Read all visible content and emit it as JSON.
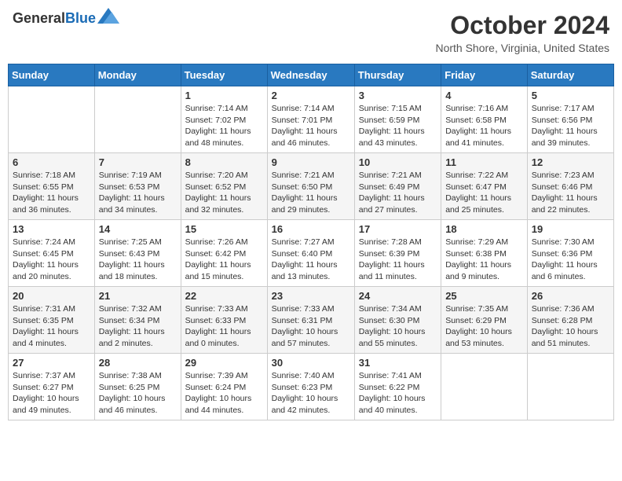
{
  "header": {
    "logo_line1": "General",
    "logo_line2": "Blue",
    "month_title": "October 2024",
    "location": "North Shore, Virginia, United States"
  },
  "days_of_week": [
    "Sunday",
    "Monday",
    "Tuesday",
    "Wednesday",
    "Thursday",
    "Friday",
    "Saturday"
  ],
  "weeks": [
    [
      {
        "day": "",
        "info": ""
      },
      {
        "day": "",
        "info": ""
      },
      {
        "day": "1",
        "info": "Sunrise: 7:14 AM\nSunset: 7:02 PM\nDaylight: 11 hours and 48 minutes."
      },
      {
        "day": "2",
        "info": "Sunrise: 7:14 AM\nSunset: 7:01 PM\nDaylight: 11 hours and 46 minutes."
      },
      {
        "day": "3",
        "info": "Sunrise: 7:15 AM\nSunset: 6:59 PM\nDaylight: 11 hours and 43 minutes."
      },
      {
        "day": "4",
        "info": "Sunrise: 7:16 AM\nSunset: 6:58 PM\nDaylight: 11 hours and 41 minutes."
      },
      {
        "day": "5",
        "info": "Sunrise: 7:17 AM\nSunset: 6:56 PM\nDaylight: 11 hours and 39 minutes."
      }
    ],
    [
      {
        "day": "6",
        "info": "Sunrise: 7:18 AM\nSunset: 6:55 PM\nDaylight: 11 hours and 36 minutes."
      },
      {
        "day": "7",
        "info": "Sunrise: 7:19 AM\nSunset: 6:53 PM\nDaylight: 11 hours and 34 minutes."
      },
      {
        "day": "8",
        "info": "Sunrise: 7:20 AM\nSunset: 6:52 PM\nDaylight: 11 hours and 32 minutes."
      },
      {
        "day": "9",
        "info": "Sunrise: 7:21 AM\nSunset: 6:50 PM\nDaylight: 11 hours and 29 minutes."
      },
      {
        "day": "10",
        "info": "Sunrise: 7:21 AM\nSunset: 6:49 PM\nDaylight: 11 hours and 27 minutes."
      },
      {
        "day": "11",
        "info": "Sunrise: 7:22 AM\nSunset: 6:47 PM\nDaylight: 11 hours and 25 minutes."
      },
      {
        "day": "12",
        "info": "Sunrise: 7:23 AM\nSunset: 6:46 PM\nDaylight: 11 hours and 22 minutes."
      }
    ],
    [
      {
        "day": "13",
        "info": "Sunrise: 7:24 AM\nSunset: 6:45 PM\nDaylight: 11 hours and 20 minutes."
      },
      {
        "day": "14",
        "info": "Sunrise: 7:25 AM\nSunset: 6:43 PM\nDaylight: 11 hours and 18 minutes."
      },
      {
        "day": "15",
        "info": "Sunrise: 7:26 AM\nSunset: 6:42 PM\nDaylight: 11 hours and 15 minutes."
      },
      {
        "day": "16",
        "info": "Sunrise: 7:27 AM\nSunset: 6:40 PM\nDaylight: 11 hours and 13 minutes."
      },
      {
        "day": "17",
        "info": "Sunrise: 7:28 AM\nSunset: 6:39 PM\nDaylight: 11 hours and 11 minutes."
      },
      {
        "day": "18",
        "info": "Sunrise: 7:29 AM\nSunset: 6:38 PM\nDaylight: 11 hours and 9 minutes."
      },
      {
        "day": "19",
        "info": "Sunrise: 7:30 AM\nSunset: 6:36 PM\nDaylight: 11 hours and 6 minutes."
      }
    ],
    [
      {
        "day": "20",
        "info": "Sunrise: 7:31 AM\nSunset: 6:35 PM\nDaylight: 11 hours and 4 minutes."
      },
      {
        "day": "21",
        "info": "Sunrise: 7:32 AM\nSunset: 6:34 PM\nDaylight: 11 hours and 2 minutes."
      },
      {
        "day": "22",
        "info": "Sunrise: 7:33 AM\nSunset: 6:33 PM\nDaylight: 11 hours and 0 minutes."
      },
      {
        "day": "23",
        "info": "Sunrise: 7:33 AM\nSunset: 6:31 PM\nDaylight: 10 hours and 57 minutes."
      },
      {
        "day": "24",
        "info": "Sunrise: 7:34 AM\nSunset: 6:30 PM\nDaylight: 10 hours and 55 minutes."
      },
      {
        "day": "25",
        "info": "Sunrise: 7:35 AM\nSunset: 6:29 PM\nDaylight: 10 hours and 53 minutes."
      },
      {
        "day": "26",
        "info": "Sunrise: 7:36 AM\nSunset: 6:28 PM\nDaylight: 10 hours and 51 minutes."
      }
    ],
    [
      {
        "day": "27",
        "info": "Sunrise: 7:37 AM\nSunset: 6:27 PM\nDaylight: 10 hours and 49 minutes."
      },
      {
        "day": "28",
        "info": "Sunrise: 7:38 AM\nSunset: 6:25 PM\nDaylight: 10 hours and 46 minutes."
      },
      {
        "day": "29",
        "info": "Sunrise: 7:39 AM\nSunset: 6:24 PM\nDaylight: 10 hours and 44 minutes."
      },
      {
        "day": "30",
        "info": "Sunrise: 7:40 AM\nSunset: 6:23 PM\nDaylight: 10 hours and 42 minutes."
      },
      {
        "day": "31",
        "info": "Sunrise: 7:41 AM\nSunset: 6:22 PM\nDaylight: 10 hours and 40 minutes."
      },
      {
        "day": "",
        "info": ""
      },
      {
        "day": "",
        "info": ""
      }
    ]
  ]
}
